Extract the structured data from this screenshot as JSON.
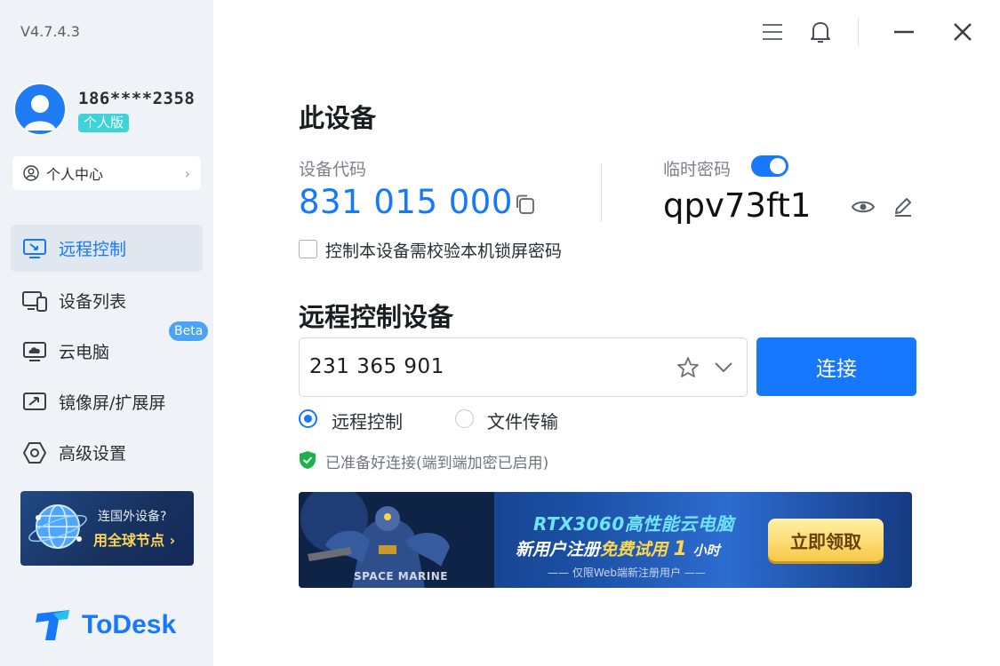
{
  "app": {
    "version": "V4.7.4.3",
    "brand": "ToDesk",
    "accent_color": "#1677ff"
  },
  "user": {
    "phone": "186****2358",
    "edition": "个人版",
    "center_label": "个人中心"
  },
  "sidebar": {
    "items": [
      {
        "label": "远程控制",
        "icon": "remote-control-icon",
        "active": true
      },
      {
        "label": "设备列表",
        "icon": "device-list-icon",
        "active": false
      },
      {
        "label": "云电脑",
        "icon": "cloud-pc-icon",
        "active": false,
        "badge": "Beta"
      },
      {
        "label": "镜像屏/扩展屏",
        "icon": "mirror-screen-icon",
        "active": false
      },
      {
        "label": "高级设置",
        "icon": "settings-hexagon-icon",
        "active": false
      }
    ],
    "promo": {
      "line1": "连国外设备?",
      "line2": "用全球节点"
    }
  },
  "this_device": {
    "title": "此设备",
    "code_label": "设备代码",
    "code": "831 015 000",
    "temp_password_label": "临时密码",
    "temp_password": "qpv73ft1",
    "temp_password_enabled": true,
    "lock_check_label": "控制本设备需校验本机锁屏密码",
    "lock_check_checked": false
  },
  "remote": {
    "title": "远程控制设备",
    "input_value": "231 365 901",
    "connect_label": "连接",
    "modes": [
      {
        "label": "远程控制",
        "selected": true
      },
      {
        "label": "文件传输",
        "selected": false
      }
    ],
    "status": "已准备好连接(端到端加密已启用)"
  },
  "banner": {
    "line1": "RTX3060高性能云电脑",
    "line2_a": "新用户注册",
    "line2_b": "免费试用",
    "line2_c": "1",
    "line2_d": "小时",
    "line3": "—— 仅限Web端新注册用户 ——",
    "cta": "立即领取",
    "game": "SPACE MARINE"
  }
}
